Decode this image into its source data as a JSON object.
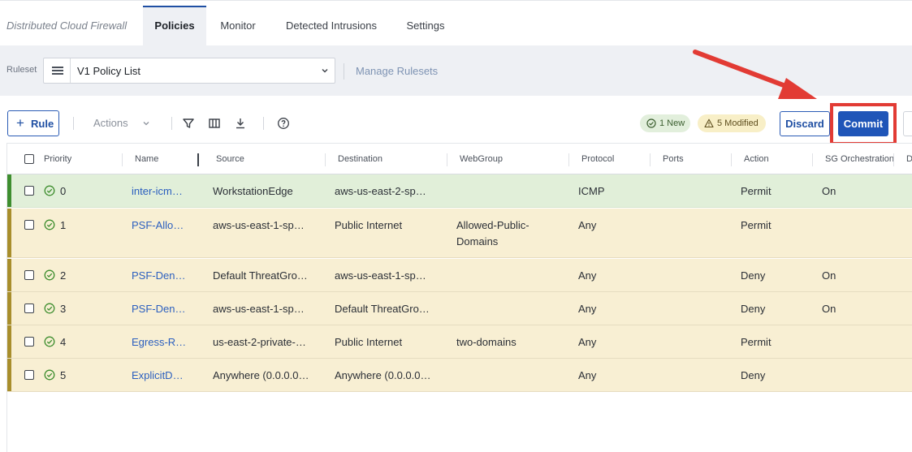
{
  "app": {
    "title": "Distributed Cloud Firewall",
    "tabs": [
      "Policies",
      "Monitor",
      "Detected Intrusions",
      "Settings"
    ]
  },
  "ruleset": {
    "label": "Ruleset",
    "selected": "V1 Policy List",
    "manage_link": "Manage Rulesets"
  },
  "toolbar": {
    "rule_label": "Rule",
    "actions_label": "Actions",
    "badge_new": "1 New",
    "badge_modified": "5 Modified",
    "discard_label": "Discard",
    "commit_label": "Commit"
  },
  "table": {
    "columns": [
      "Priority",
      "Name",
      "Source",
      "Destination",
      "WebGroup",
      "Protocol",
      "Ports",
      "Action",
      "SG Orchestration",
      "D"
    ],
    "rows": [
      {
        "priority": "0",
        "name": "inter-icm…",
        "source": "WorkstationEdge",
        "destination": "aws-us-east-2-sp…",
        "webgroup": "",
        "protocol": "ICMP",
        "ports": "",
        "action": "Permit",
        "sg": "On",
        "state": "new"
      },
      {
        "priority": "1",
        "name": "PSF-Allo…",
        "source": "aws-us-east-1-sp…",
        "destination": "Public Internet",
        "webgroup": "Allowed-Public-Domains",
        "protocol": "Any",
        "ports": "",
        "action": "Permit",
        "sg": "",
        "state": "modified"
      },
      {
        "priority": "2",
        "name": "PSF-Den…",
        "source": "Default ThreatGro…",
        "destination": "aws-us-east-1-sp…",
        "webgroup": "",
        "protocol": "Any",
        "ports": "",
        "action": "Deny",
        "sg": "On",
        "state": "modified"
      },
      {
        "priority": "3",
        "name": "PSF-Den…",
        "source": "aws-us-east-1-sp…",
        "destination": "Default ThreatGro…",
        "webgroup": "",
        "protocol": "Any",
        "ports": "",
        "action": "Deny",
        "sg": "On",
        "state": "modified"
      },
      {
        "priority": "4",
        "name": "Egress-R…",
        "source": "us-east-2-private-…",
        "destination": "Public Internet",
        "webgroup": "two-domains",
        "protocol": "Any",
        "ports": "",
        "action": "Permit",
        "sg": "",
        "state": "modified"
      },
      {
        "priority": "5",
        "name": "ExplicitD…",
        "source": "Anywhere (0.0.0.0…",
        "destination": "Anywhere (0.0.0.0…",
        "webgroup": "",
        "protocol": "Any",
        "ports": "",
        "action": "Deny",
        "sg": "",
        "state": "modified"
      }
    ]
  },
  "colors": {
    "accent": "#1f55b8",
    "highlight": "#e23b34",
    "new_row": "#e1efd9",
    "modified_row": "#f8efd3"
  }
}
